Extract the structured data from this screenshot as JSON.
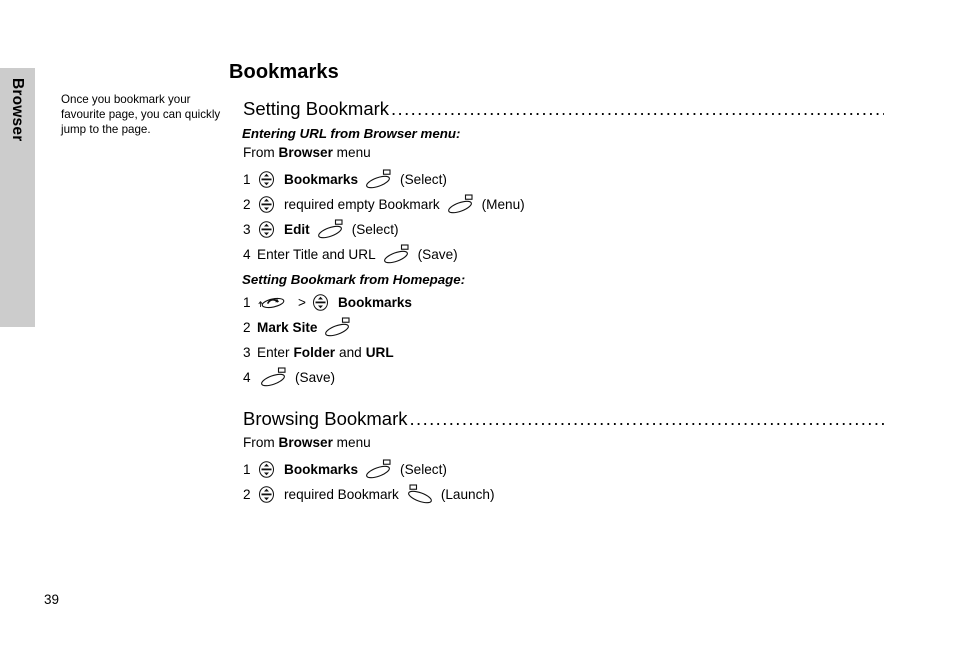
{
  "side_tab": {
    "label": "Browser"
  },
  "margin_note": {
    "text": "Once you bookmark your favourite page, you can quickly jump to the page."
  },
  "chapter": {
    "title": "Bookmarks"
  },
  "leader_dots": "...........................................................................................................................................",
  "sections": [
    {
      "heading": "Setting Bookmark",
      "subheading": "Entering URL from Browser menu:",
      "intro": [
        {
          "text": "From ",
          "style": "plain"
        },
        {
          "text": "Browser",
          "style": "bold"
        },
        {
          "text": " menu",
          "style": "plain"
        }
      ],
      "steps": [
        {
          "num": "1",
          "tokens": [
            {
              "type": "icon",
              "icon": "nav-key-icon"
            },
            {
              "type": "text",
              "text": "Bookmarks",
              "style": "bold"
            },
            {
              "type": "icon",
              "icon": "select-softkey-icon"
            },
            {
              "type": "text",
              "text": "(Select)",
              "style": "plain"
            }
          ]
        },
        {
          "num": "2",
          "tokens": [
            {
              "type": "icon",
              "icon": "nav-key-icon"
            },
            {
              "type": "text",
              "text": "required empty Bookmark",
              "style": "plain"
            },
            {
              "type": "icon",
              "icon": "select-softkey-icon"
            },
            {
              "type": "text",
              "text": "(Menu)",
              "style": "plain"
            }
          ]
        },
        {
          "num": "3",
          "tokens": [
            {
              "type": "icon",
              "icon": "nav-key-icon"
            },
            {
              "type": "text",
              "text": "Edit",
              "style": "bold"
            },
            {
              "type": "icon",
              "icon": "select-softkey-icon"
            },
            {
              "type": "text",
              "text": "(Select)",
              "style": "plain"
            }
          ]
        },
        {
          "num": "4",
          "tokens": [
            {
              "type": "text",
              "text": "Enter Title and URL",
              "style": "plain"
            },
            {
              "type": "icon",
              "icon": "select-softkey-icon"
            },
            {
              "type": "text",
              "text": "(Save)",
              "style": "plain"
            }
          ]
        }
      ],
      "subsections": [
        {
          "subheading": "Setting Bookmark from Homepage:",
          "steps": [
            {
              "num": "1",
              "tokens": [
                {
                  "type": "icon",
                  "icon": "left-softkey-back-icon"
                },
                {
                  "type": "text",
                  "text": ">",
                  "style": "gt"
                },
                {
                  "type": "icon",
                  "icon": "nav-key-icon"
                },
                {
                  "type": "text",
                  "text": "Bookmarks",
                  "style": "bold"
                }
              ]
            },
            {
              "num": "2",
              "tokens": [
                {
                  "type": "text",
                  "text": "Mark Site",
                  "style": "bold"
                },
                {
                  "type": "icon",
                  "icon": "select-softkey-icon"
                }
              ]
            },
            {
              "num": "3",
              "tokens": [
                {
                  "type": "text",
                  "text": "Enter ",
                  "style": "plain"
                },
                {
                  "type": "text",
                  "text": "Folder",
                  "style": "bold"
                },
                {
                  "type": "text",
                  "text": " and ",
                  "style": "plain"
                },
                {
                  "type": "text",
                  "text": "URL",
                  "style": "bold"
                }
              ]
            },
            {
              "num": "4",
              "tokens": [
                {
                  "type": "icon",
                  "icon": "select-softkey-icon"
                },
                {
                  "type": "text",
                  "text": "(Save)",
                  "style": "plain"
                }
              ]
            }
          ]
        }
      ]
    },
    {
      "heading": "Browsing Bookmark",
      "subheading": "",
      "intro": [
        {
          "text": "From ",
          "style": "plain"
        },
        {
          "text": "Browser",
          "style": "bold"
        },
        {
          "text": " menu",
          "style": "plain"
        }
      ],
      "steps": [
        {
          "num": "1",
          "tokens": [
            {
              "type": "icon",
              "icon": "nav-key-icon"
            },
            {
              "type": "text",
              "text": "Bookmarks",
              "style": "bold"
            },
            {
              "type": "icon",
              "icon": "select-softkey-icon"
            },
            {
              "type": "text",
              "text": "(Select)",
              "style": "plain"
            }
          ]
        },
        {
          "num": "2",
          "tokens": [
            {
              "type": "icon",
              "icon": "nav-key-icon"
            },
            {
              "type": "text",
              "text": "required Bookmark",
              "style": "plain"
            },
            {
              "type": "icon",
              "icon": "right-softkey-icon"
            },
            {
              "type": "text",
              "text": "(Launch)",
              "style": "plain"
            }
          ]
        }
      ],
      "subsections": []
    }
  ],
  "page_number": "39",
  "colors": {
    "tab_background": "#cccccc",
    "text": "#000000",
    "page_background": "#ffffff"
  }
}
